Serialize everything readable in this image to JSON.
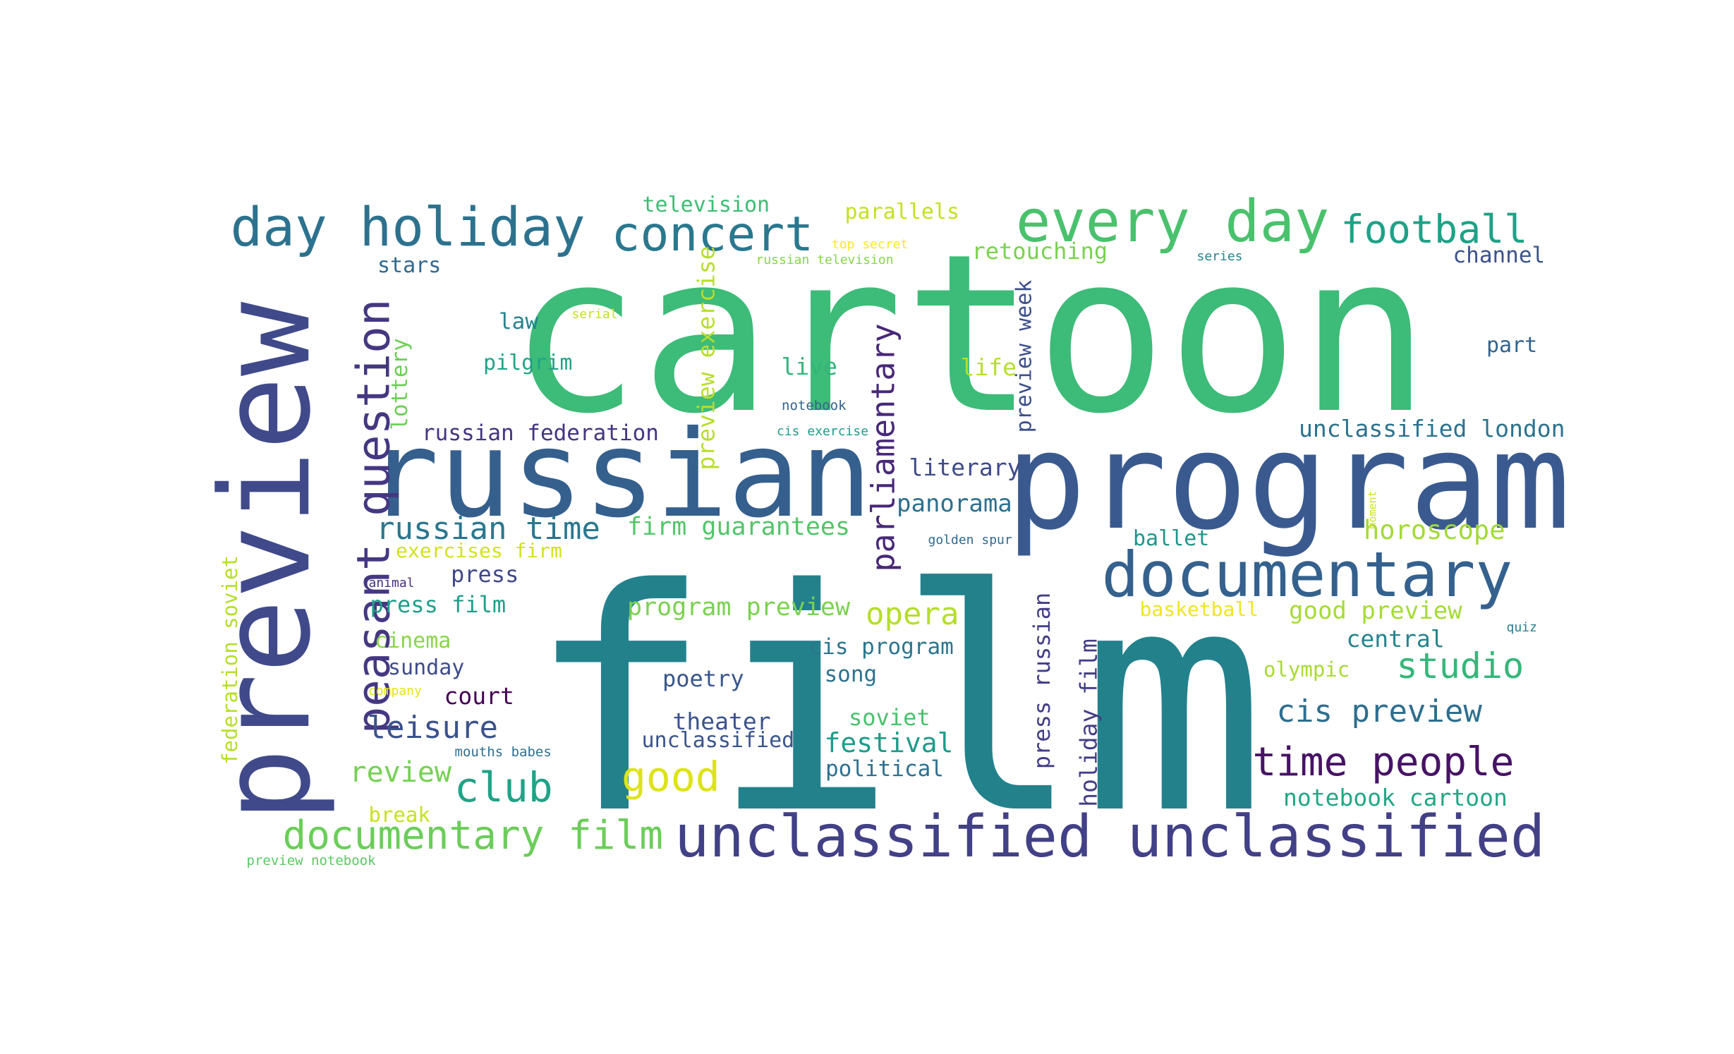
{
  "words": [
    {
      "text": "cartoon",
      "color": "#3dbb78",
      "vertical": false
    },
    {
      "text": "film",
      "color": "#23818c",
      "vertical": false
    },
    {
      "text": "program",
      "color": "#3a5a8f",
      "vertical": false
    },
    {
      "text": "russian",
      "color": "#355f8d",
      "vertical": false
    },
    {
      "text": "preview",
      "color": "#404a8a",
      "vertical": true
    },
    {
      "text": "unclassified unclassified",
      "color": "#424086",
      "vertical": false
    },
    {
      "text": "documentary",
      "color": "#34618d",
      "vertical": false
    },
    {
      "text": "every day",
      "color": "#4ac16d",
      "vertical": false
    },
    {
      "text": "day holiday",
      "color": "#2c728e",
      "vertical": false
    },
    {
      "text": "concert",
      "color": "#2a788e",
      "vertical": false
    },
    {
      "text": "peasant question",
      "color": "#453781",
      "vertical": true
    },
    {
      "text": "football",
      "color": "#1fa187",
      "vertical": false
    },
    {
      "text": "documentary film",
      "color": "#6ccd5a",
      "vertical": false
    },
    {
      "text": "time people",
      "color": "#471365",
      "vertical": false
    },
    {
      "text": "parliamentary",
      "color": "#482878",
      "vertical": true
    },
    {
      "text": "good",
      "color": "#dde318",
      "vertical": false
    },
    {
      "text": "club",
      "color": "#20a386",
      "vertical": false
    },
    {
      "text": "studio",
      "color": "#35b779",
      "vertical": false
    },
    {
      "text": "cis preview",
      "color": "#2e6e8e",
      "vertical": false
    },
    {
      "text": "russian time",
      "color": "#2a768e",
      "vertical": false
    },
    {
      "text": "leisure",
      "color": "#3b528b",
      "vertical": false
    },
    {
      "text": "opera",
      "color": "#b5de2b",
      "vertical": false
    },
    {
      "text": "review",
      "color": "#75d054",
      "vertical": false
    },
    {
      "text": "firm guarantees",
      "color": "#52c569",
      "vertical": false
    },
    {
      "text": "program preview",
      "color": "#7ad151",
      "vertical": false
    },
    {
      "text": "panorama",
      "color": "#2d708e",
      "vertical": false
    },
    {
      "text": "horoscope",
      "color": "#a2da37",
      "vertical": false
    },
    {
      "text": "literary",
      "color": "#3e4a89",
      "vertical": false
    },
    {
      "text": "unclassified london",
      "color": "#2c728e",
      "vertical": false
    },
    {
      "text": "press russian",
      "color": "#433e85",
      "vertical": true
    },
    {
      "text": "holiday film",
      "color": "#433d84",
      "vertical": true
    },
    {
      "text": "preview exercise",
      "color": "#b8de29",
      "vertical": true
    },
    {
      "text": "preview week",
      "color": "#3c4f8a",
      "vertical": true
    },
    {
      "text": "festival",
      "color": "#1e9b8a",
      "vertical": false
    },
    {
      "text": "federation soviet",
      "color": "#b5de2b",
      "vertical": true
    },
    {
      "text": "notebook cartoon",
      "color": "#22a785",
      "vertical": false
    },
    {
      "text": "good preview",
      "color": "#a5db36",
      "vertical": false
    },
    {
      "text": "central",
      "color": "#25838e",
      "vertical": false
    },
    {
      "text": "poetry",
      "color": "#39568c",
      "vertical": false
    },
    {
      "text": "theater",
      "color": "#3b528b",
      "vertical": false
    },
    {
      "text": "unclassified",
      "color": "#3a548c",
      "vertical": false
    },
    {
      "text": "soviet",
      "color": "#4ac16d",
      "vertical": false
    },
    {
      "text": "political",
      "color": "#2d708e",
      "vertical": false
    },
    {
      "text": "song",
      "color": "#2c728e",
      "vertical": false
    },
    {
      "text": "cis program",
      "color": "#2a768e",
      "vertical": false
    },
    {
      "text": "court",
      "color": "#440154",
      "vertical": false
    },
    {
      "text": "sunday",
      "color": "#3e4c8a",
      "vertical": false
    },
    {
      "text": "cinema",
      "color": "#89d548",
      "vertical": false
    },
    {
      "text": "press film",
      "color": "#1f9e89",
      "vertical": false
    },
    {
      "text": "press",
      "color": "#3f4788",
      "vertical": false
    },
    {
      "text": "exercises firm",
      "color": "#d2e21b",
      "vertical": false
    },
    {
      "text": "russian federation",
      "color": "#453581",
      "vertical": false
    },
    {
      "text": "lottery",
      "color": "#6ece58",
      "vertical": true
    },
    {
      "text": "pilgrim",
      "color": "#20a386",
      "vertical": false
    },
    {
      "text": "law",
      "color": "#25848e",
      "vertical": false
    },
    {
      "text": "stars",
      "color": "#31688e",
      "vertical": false
    },
    {
      "text": "television",
      "color": "#3dbc74",
      "vertical": false
    },
    {
      "text": "parallels",
      "color": "#c5e021",
      "vertical": false
    },
    {
      "text": "retouching",
      "color": "#7ad151",
      "vertical": false
    },
    {
      "text": "channel",
      "color": "#3b528b",
      "vertical": false
    },
    {
      "text": "part",
      "color": "#33638d",
      "vertical": false
    },
    {
      "text": "live",
      "color": "#32b67a",
      "vertical": false
    },
    {
      "text": "life",
      "color": "#b5de2b",
      "vertical": false
    },
    {
      "text": "ballet",
      "color": "#1f958b",
      "vertical": false
    },
    {
      "text": "basketball",
      "color": "#f1e51d",
      "vertical": false
    },
    {
      "text": "olympic",
      "color": "#a8db34",
      "vertical": false
    },
    {
      "text": "break",
      "color": "#c8e020",
      "vertical": false
    },
    {
      "text": "preview notebook",
      "color": "#5ac864",
      "vertical": false
    },
    {
      "text": "top secret",
      "color": "#fde725",
      "vertical": false
    },
    {
      "text": "russian television",
      "color": "#86d549",
      "vertical": false
    },
    {
      "text": "serial",
      "color": "#c2df23",
      "vertical": false
    },
    {
      "text": "series",
      "color": "#27808e",
      "vertical": false
    },
    {
      "text": "notebook",
      "color": "#33638d",
      "vertical": false
    },
    {
      "text": "cis exercise",
      "color": "#1f9a8a",
      "vertical": false
    },
    {
      "text": "golden spur",
      "color": "#30698e",
      "vertical": false
    },
    {
      "text": "moment",
      "color": "#cae11f",
      "vertical": true
    },
    {
      "text": "quiz",
      "color": "#287c8e",
      "vertical": false
    },
    {
      "text": "animal",
      "color": "#46307e",
      "vertical": false
    },
    {
      "text": "company",
      "color": "#e5e419",
      "vertical": false
    },
    {
      "text": "mouths babes",
      "color": "#2e6f8e",
      "vertical": false
    }
  ]
}
